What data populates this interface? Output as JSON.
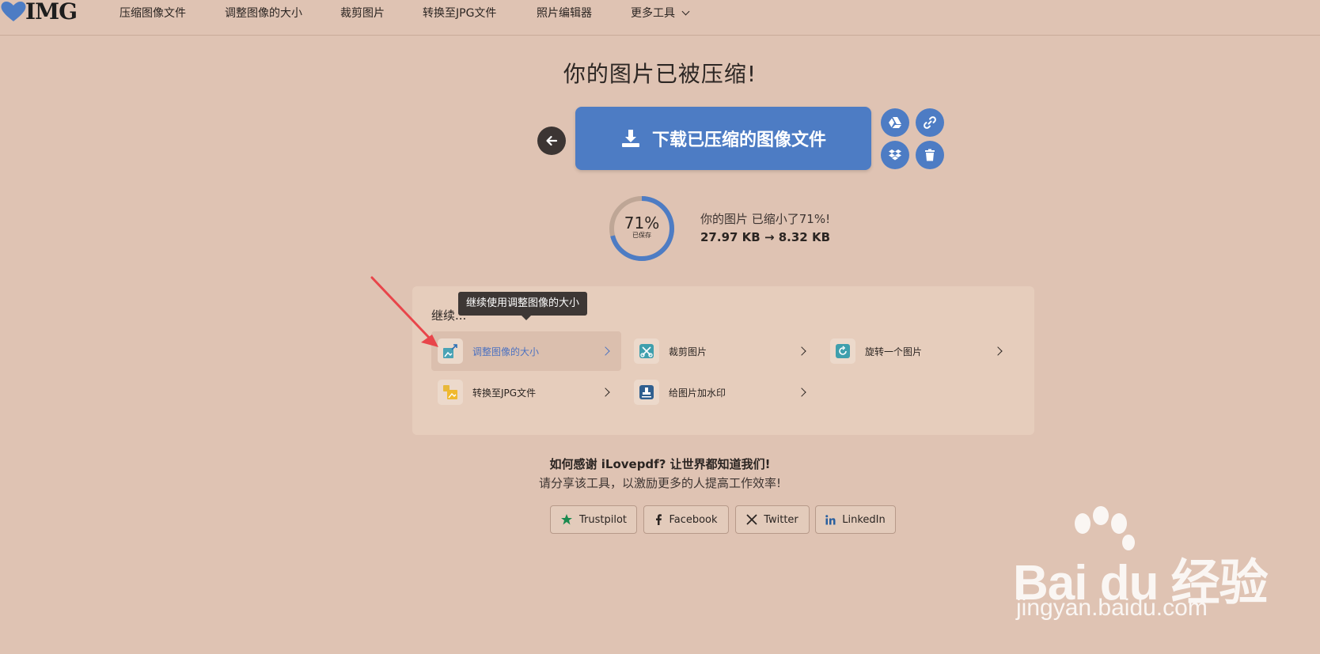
{
  "nav": {
    "logo_text": "IMG",
    "items": [
      {
        "label": "压缩图像文件"
      },
      {
        "label": "调整图像的大小"
      },
      {
        "label": "裁剪图片"
      },
      {
        "label": "转换至JPG文件"
      },
      {
        "label": "照片编辑器"
      },
      {
        "label": "更多工具"
      }
    ]
  },
  "headline": "你的图片已被压缩!",
  "download_label": "下载已压缩的图像文件",
  "stats": {
    "percent_text": "71%",
    "percent_value": 71,
    "saved_label": "已保存",
    "line1": "你的图片 已缩小了71%!",
    "line2": "27.97 KB → 8.32 KB"
  },
  "continue": {
    "title": "继续...",
    "tooltip": "继续使用调整图像的大小",
    "tools": [
      {
        "label": "调整图像的大小",
        "icon": "resize-icon",
        "active": true
      },
      {
        "label": "裁剪图片",
        "icon": "crop-icon"
      },
      {
        "label": "旋转一个图片",
        "icon": "rotate-icon"
      },
      {
        "label": "转换至JPG文件",
        "icon": "convert-jpg-icon"
      },
      {
        "label": "给图片加水印",
        "icon": "watermark-icon"
      }
    ]
  },
  "share": {
    "title": "如何感谢 iLovepdf? 让世界都知道我们!",
    "subtitle": "请分享该工具，以激励更多的人提高工作效率!",
    "buttons": [
      {
        "label": "Trustpilot",
        "icon": "star-icon"
      },
      {
        "label": "Facebook",
        "icon": "facebook-icon"
      },
      {
        "label": "Twitter",
        "icon": "x-icon"
      },
      {
        "label": "LinkedIn",
        "icon": "linkedin-icon"
      }
    ]
  },
  "watermark": {
    "brand": "Bai du 经验",
    "url": "jingyan.baidu.com"
  },
  "colors": {
    "background": "#dfc3b3",
    "accent": "#4d7cc4",
    "arrow": "#e8454a"
  }
}
